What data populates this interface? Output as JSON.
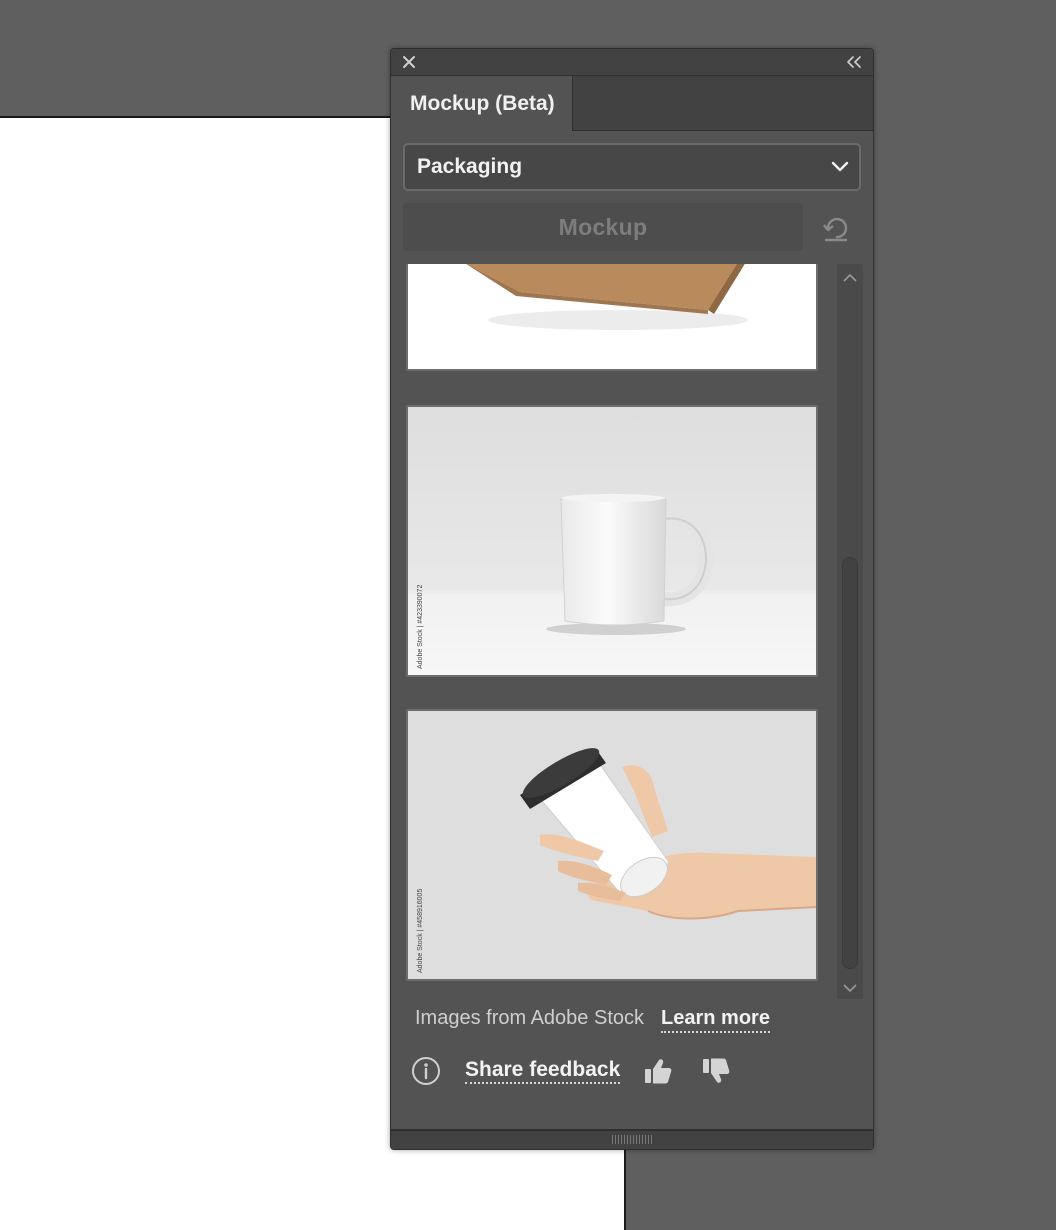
{
  "panel": {
    "tab_label": "Mockup (Beta)",
    "category": {
      "selected": "Packaging"
    },
    "mockup_button": "Mockup",
    "thumbnails": [
      {
        "subject": "kraft-box",
        "credit": ""
      },
      {
        "subject": "white-mug",
        "credit": "Adobe Stock | #423390072"
      },
      {
        "subject": "coffee-cup-in-hand",
        "credit": "Adobe Stock | #458916005"
      }
    ],
    "footer": {
      "stock_text": "Images from Adobe Stock",
      "learn_more": "Learn more",
      "share_feedback": "Share feedback"
    }
  },
  "icons": {
    "close": "close-icon",
    "collapse": "double-chevron-left-icon",
    "dropdown": "chevron-down-icon",
    "reset": "reset-icon",
    "info": "info-icon",
    "thumbs_up": "thumbs-up-icon",
    "thumbs_down": "thumbs-down-icon"
  },
  "colors": {
    "canvas_bg": "#5f5f5f",
    "artboard": "#ffffff",
    "panel_bg": "#535353",
    "panel_header": "#424242"
  }
}
